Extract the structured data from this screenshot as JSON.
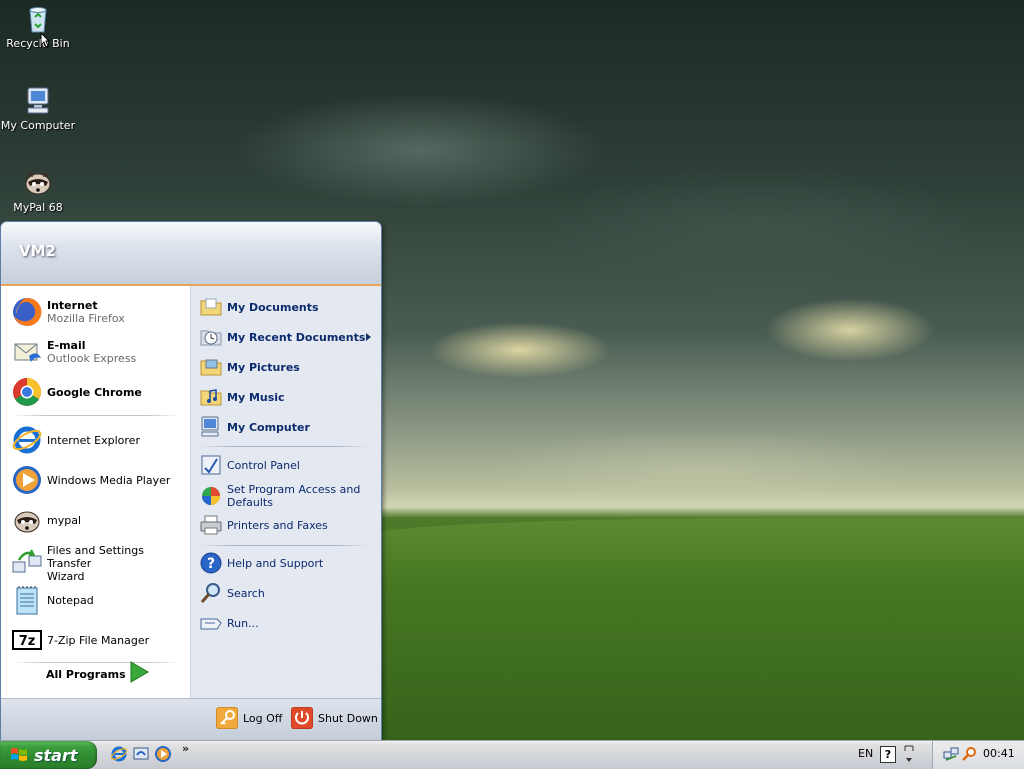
{
  "desktop": {
    "icons": [
      {
        "label": "Recycle Bin"
      },
      {
        "label": "My Computer"
      },
      {
        "label": "MyPal 68"
      }
    ]
  },
  "start_menu": {
    "user": "VM2",
    "pinned": [
      {
        "name": "Internet",
        "sub": "Mozilla Firefox"
      },
      {
        "name": "E-mail",
        "sub": "Outlook Express"
      },
      {
        "name": "Google Chrome"
      }
    ],
    "recent": [
      {
        "name": "Internet Explorer"
      },
      {
        "name": "Windows Media Player"
      },
      {
        "name": "mypal"
      },
      {
        "name": "Files and Settings Transfer",
        "name2": "Wizard"
      },
      {
        "name": "Notepad"
      },
      {
        "name": "7-Zip File Manager"
      }
    ],
    "all_programs": "All Programs",
    "places": [
      {
        "name": "My Documents"
      },
      {
        "name": "My Recent Documents"
      },
      {
        "name": "My Pictures"
      },
      {
        "name": "My Music"
      },
      {
        "name": "My Computer"
      }
    ],
    "settings": [
      {
        "name": "Control Panel"
      },
      {
        "name": "Set Program Access and",
        "name2": "Defaults"
      },
      {
        "name": "Printers and Faxes"
      }
    ],
    "tools": [
      {
        "name": "Help and Support"
      },
      {
        "name": "Search"
      },
      {
        "name": "Run..."
      }
    ],
    "footer": {
      "log_off": "Log Off",
      "shut_down": "Shut Down"
    }
  },
  "taskbar": {
    "start_label": "start",
    "quicklaunch_more": "»",
    "language": "EN",
    "help_glyph": "?",
    "clock": "00:41"
  },
  "colors": {
    "start_green": "#3c9e3c",
    "menu_header_border": "#e9a55a",
    "places_text": "#0c2a6e"
  }
}
